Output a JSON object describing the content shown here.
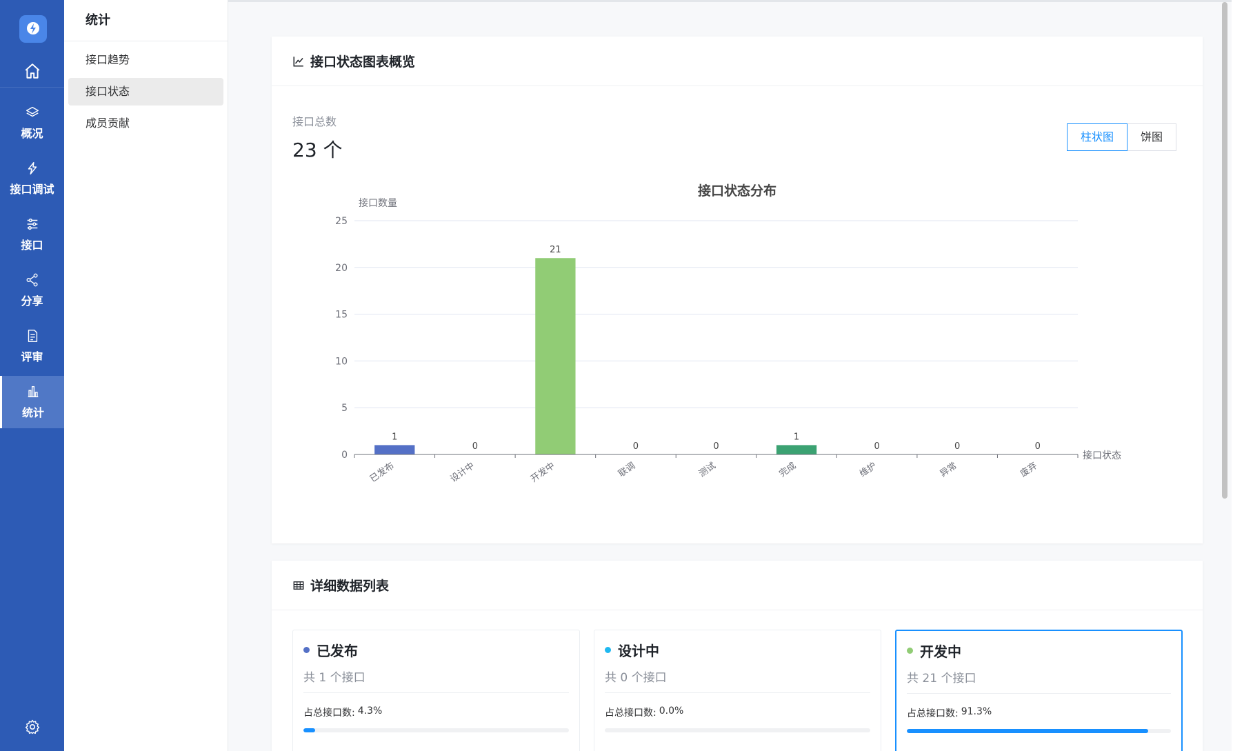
{
  "sidebar": {
    "items": [
      {
        "label": "概况",
        "icon": "layers-icon"
      },
      {
        "label": "接口调试",
        "icon": "lightning-icon"
      },
      {
        "label": "接口",
        "icon": "sliders-icon"
      },
      {
        "label": "分享",
        "icon": "share-icon"
      },
      {
        "label": "评审",
        "icon": "review-icon"
      },
      {
        "label": "统计",
        "icon": "bar-chart-icon",
        "active": true
      }
    ],
    "active_color": "#5078c6",
    "bg_color": "#2d5bb5"
  },
  "submenu": {
    "title": "统计",
    "items": [
      {
        "label": "接口趋势"
      },
      {
        "label": "接口状态",
        "active": true
      },
      {
        "label": "成员贡献"
      }
    ]
  },
  "overview": {
    "title": "接口状态图表概览",
    "total_label": "接口总数",
    "total_value": "23 个",
    "tabs": [
      {
        "label": "柱状图",
        "active": true
      },
      {
        "label": "饼图"
      }
    ]
  },
  "chart_data": {
    "type": "bar",
    "title": "接口状态分布",
    "ylabel": "接口数量",
    "xlabel": "接口状态",
    "ylim": [
      0,
      25
    ],
    "yticks": [
      0,
      5,
      10,
      15,
      20,
      25
    ],
    "grid": true,
    "categories": [
      "已发布",
      "设计中",
      "开发中",
      "联调",
      "测试",
      "完成",
      "维护",
      "异常",
      "废弃"
    ],
    "values": [
      1,
      0,
      21,
      0,
      0,
      1,
      0,
      0,
      0
    ],
    "colors": [
      "#5470c6",
      "#91cc75",
      "#91cc75",
      "#91cc75",
      "#91cc75",
      "#3ba272",
      "#91cc75",
      "#91cc75",
      "#91cc75"
    ]
  },
  "details": {
    "title": "详细数据列表",
    "pct_label": "占总接口数:",
    "cards": [
      {
        "name": "已发布",
        "count_text": "共 1 个接口",
        "pct_text": "4.3%",
        "pct": 0.043,
        "dot_color": "#5470c6"
      },
      {
        "name": "设计中",
        "count_text": "共 0 个接口",
        "pct_text": "0.0%",
        "pct": 0.0,
        "dot_color": "#1fb8f0"
      },
      {
        "name": "开发中",
        "count_text": "共 21 个接口",
        "pct_text": "91.3%",
        "pct": 0.913,
        "dot_color": "#91cc75"
      }
    ]
  }
}
